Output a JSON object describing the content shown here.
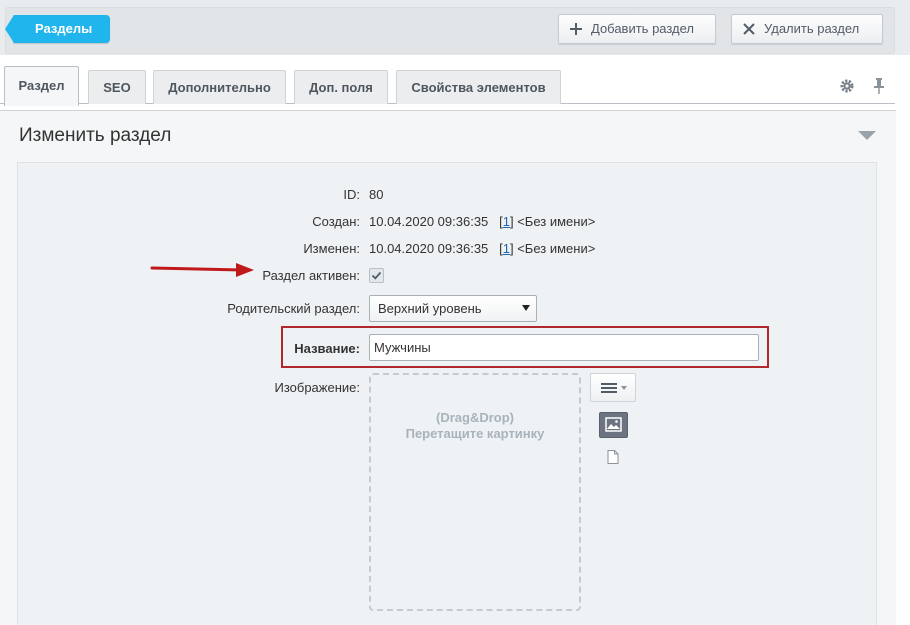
{
  "toolbar": {
    "back_label": "Разделы",
    "add_label": "Добавить раздел",
    "delete_label": "Удалить раздел"
  },
  "tabs": [
    {
      "label": "Раздел",
      "active": true
    },
    {
      "label": "SEO",
      "active": false
    },
    {
      "label": "Дополнительно",
      "active": false
    },
    {
      "label": "Доп. поля",
      "active": false
    },
    {
      "label": "Свойства элементов",
      "active": false
    }
  ],
  "panel": {
    "title": "Изменить раздел"
  },
  "form": {
    "id_label": "ID:",
    "id_value": "80",
    "created_label": "Создан:",
    "created_value": "10.04.2020 09:36:35",
    "created_user_link": "1",
    "created_user_name": "<Без имени>",
    "modified_label": "Изменен:",
    "modified_value": "10.04.2020 09:36:35",
    "modified_user_link": "1",
    "modified_user_name": "<Без имени>",
    "active_label": "Раздел активен:",
    "active_checked": true,
    "parent_label": "Родительский раздел:",
    "parent_value": "Верхний уровень",
    "name_label": "Название:",
    "name_value": "Мужчины",
    "image_label": "Изображение:",
    "dropzone_line1": "(Drag&Drop)",
    "dropzone_line2": "Перетащите картинку"
  },
  "colors": {
    "accent": "#20b5ec",
    "highlight": "#b0282c",
    "annotation_arrow": "#c0191c",
    "link": "#2067b0"
  }
}
